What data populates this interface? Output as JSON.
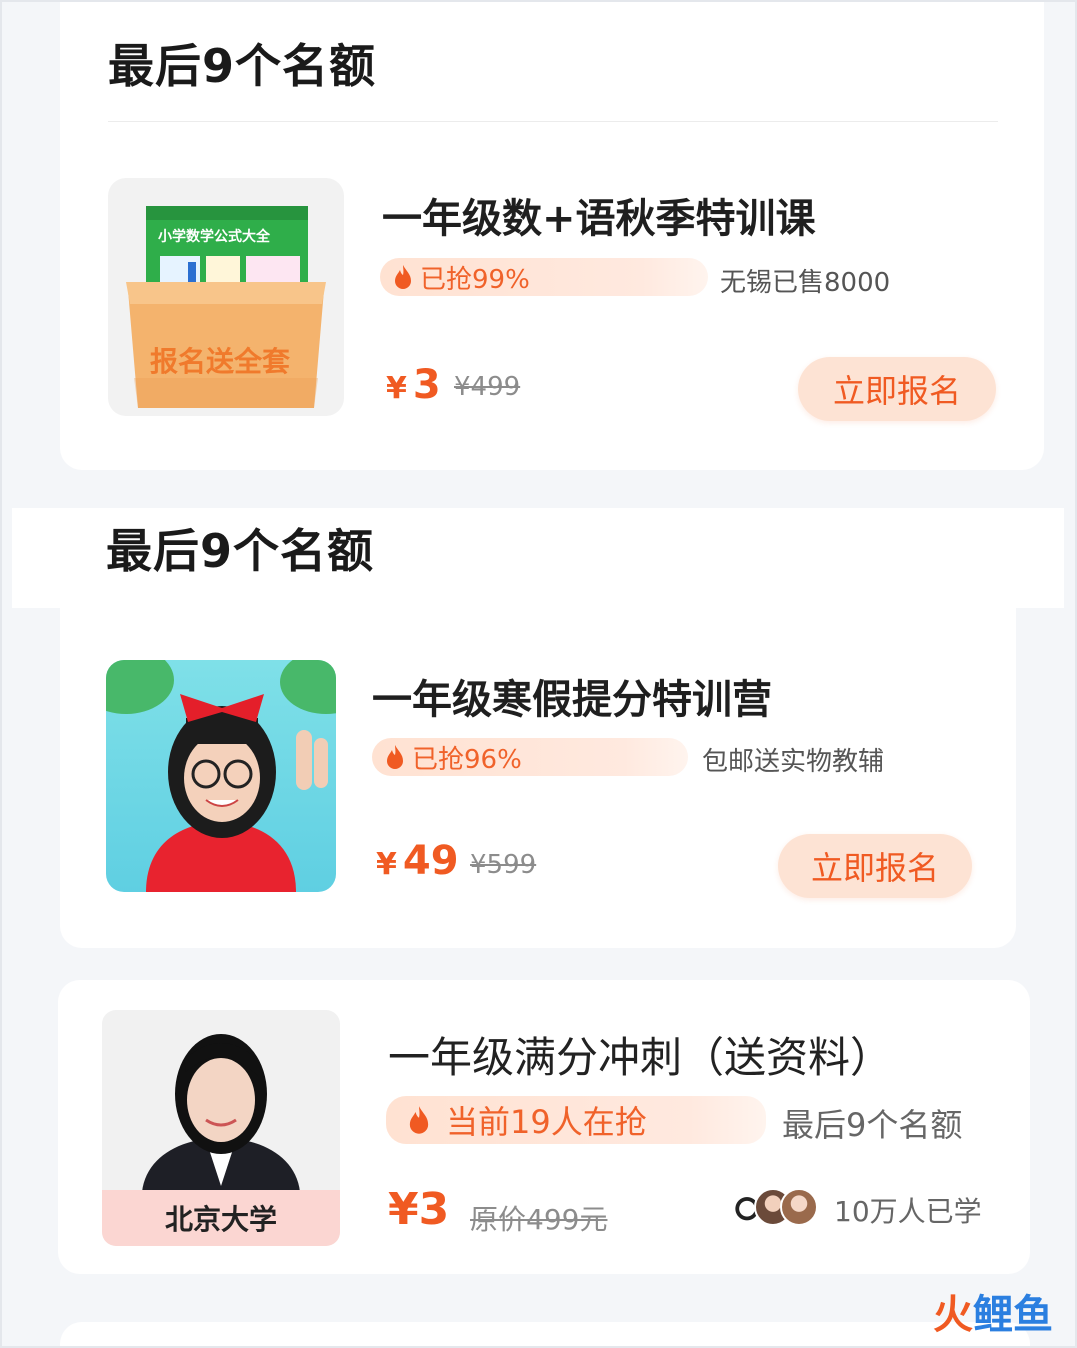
{
  "colors": {
    "accent": "#f05a22",
    "progress_bg": "#ffe2d2",
    "cta_bg": "#fde3d4",
    "page_bg": "#f4f6f9"
  },
  "sections": [
    {
      "title": "最后9个名额",
      "course": {
        "title": "一年级数+语秋季特训课",
        "progress_label": "已抢99%",
        "side_note": "无锡已售8000",
        "price_symbol": "¥",
        "price": "3",
        "original_price": "¥499",
        "cta": "立即报名",
        "thumb_book_title": "小学数学公式大全",
        "thumb_box_label": "报名送全套"
      }
    },
    {
      "title": "最后9个名额",
      "course": {
        "title": "一年级寒假提分特训营",
        "progress_label": "已抢96%",
        "side_note": "包邮送实物教辅",
        "price_symbol": "¥",
        "price": "49",
        "original_price": "¥599",
        "cta": "立即报名"
      }
    }
  ],
  "course3": {
    "title": "一年级满分冲刺（送资料）",
    "progress_label": "当前19人在抢",
    "side_note": "最后9个名额",
    "price": "¥3",
    "original_price": "原价499元",
    "learners": "10万人已学",
    "school_badge": "北京大学"
  },
  "watermark": {
    "part1": "火",
    "part2": "鲤",
    "part3": "鱼"
  },
  "icons": [
    "flame-icon",
    "avatar-icon"
  ]
}
